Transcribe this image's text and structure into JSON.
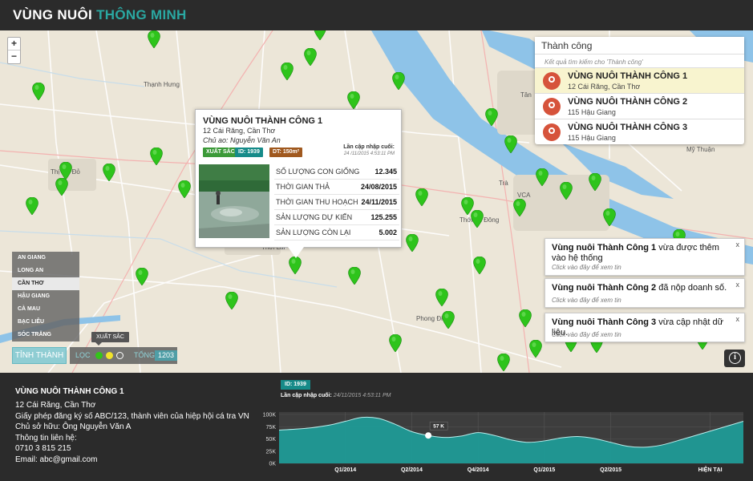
{
  "header": {
    "brand_part1": "VÙNG NUÔI",
    "brand_part2": "THÔNG MINH"
  },
  "map": {
    "zoom_in": "+",
    "zoom_out": "−",
    "places": [
      "Thạnh Hưng",
      "Thị Cờ Đỏ",
      "Thới Lai",
      "Tân",
      "Mỹ Thuận",
      "Trà",
      "Thới An Đông",
      "Phong Điền",
      "VCA"
    ]
  },
  "search": {
    "query": "Thành công",
    "caption": "Kết quả tìm kiếm cho 'Thành công'",
    "results": [
      {
        "name": "VÙNG NUÔI THÀNH CÔNG 1",
        "address": "12 Cái Răng, Cần Thơ"
      },
      {
        "name": "VÙNG NUÔI THÀNH CÔNG 2",
        "address": "115 Hậu Giang"
      },
      {
        "name": "VÙNG NUÔI THÀNH CÔNG 3",
        "address": "115 Hậu Giang"
      }
    ]
  },
  "popup": {
    "title": "VÙNG NUÔI THÀNH CÔNG 1",
    "address": "12 Cái Răng, Cần Thơ",
    "owner": "Chủ ao: Nguyễn Văn An",
    "tag_grade": "XUẤT SẮC",
    "tag_id": "ID: 1939",
    "tag_area": "DT: 150m²",
    "updated_label": "Lần cập nhập cuối:",
    "updated_time": "24 /11/2015 4:53:11 PM",
    "stats": [
      {
        "label": "SỐ LƯỢNG CON GIỐNG",
        "value": "12.345"
      },
      {
        "label": "THỜI GIAN THẢ",
        "value": "24/08/2015"
      },
      {
        "label": "THỜI GIAN THU HOẠCH",
        "value": "24/11/2015"
      },
      {
        "label": "SẢN LƯỢNG DỰ KIẾN",
        "value": "125.255"
      },
      {
        "label": "SẢN LƯỢNG CÒN LẠI",
        "value": "5.002"
      }
    ]
  },
  "provinces": [
    "AN GIANG",
    "LONG AN",
    "CẦN THƠ",
    "HẬU GIANG",
    "CÀ MAU",
    "BẠC LIÊU",
    "SÓC TRĂNG"
  ],
  "active_province": "CẦN THƠ",
  "filter": {
    "province_button": "TỈNH THÀNH",
    "filter_label": "LỌC",
    "tooltip": "XUẤT SẮC",
    "total_label": "TỔNG",
    "total_value": "1203",
    "dot_colors": [
      "#34c419",
      "#f2e42a",
      "#ffffff"
    ]
  },
  "notifications": [
    {
      "bold": "Vùng nuôi Thành Công 1",
      "text": " vừa được thêm vào hệ thống",
      "sub": "Click vào đây để xem tin"
    },
    {
      "bold": "Vùng nuôi Thành Công 2",
      "text": " đã nộp doanh số.",
      "sub": "Click vào đây để xem tin"
    },
    {
      "bold": "Vùng nuôi Thành Công 3",
      "text": " vừa cập nhật dữ liệu.",
      "sub": "Click vào đây để xem tin"
    }
  ],
  "info_button": "i",
  "farm": {
    "title": "VÙNG NUÔI THÀNH CÔNG 1",
    "lines": [
      "12 Cái Răng, Cần Thơ",
      "Giấy phép đăng ký số ABC/123, thành viên của hiệp hội cá tra VN",
      "Chủ sở hữu: Ông Nguyễn Văn A",
      "Thông tin liên hệ:",
      "0710 3 815 215",
      "Email: abc@gmail.com"
    ]
  },
  "chart_header": {
    "id_badge": "ID: 1939",
    "updated_label": "Lần cập nhập cuối:",
    "updated_time": "24/11/2015 4:53:11 PM"
  },
  "colors": {
    "accent": "#2aa8a2",
    "pin": "#2ec41b",
    "chart_fill": "#1f9a96",
    "header_bg": "#2b2b2b"
  },
  "chart_data": {
    "type": "area",
    "x": [
      0,
      0.25,
      0.5,
      0.75,
      1,
      1.25,
      1.5,
      1.75,
      2,
      2.25,
      2.5,
      2.75,
      3,
      3.25,
      3.5,
      3.75,
      4,
      4.25,
      4.5,
      4.75,
      5,
      5.25,
      5.5,
      5.75,
      6,
      6.25,
      6.5,
      6.75,
      7
    ],
    "values": [
      68,
      70,
      73,
      78,
      86,
      94,
      92,
      80,
      65,
      57,
      53,
      56,
      63,
      57,
      48,
      43,
      46,
      52,
      55,
      51,
      43,
      35,
      33,
      37,
      46,
      56,
      66,
      76,
      86
    ],
    "categories": [
      "Q1/2014",
      "Q2/2014",
      "Q4/2014",
      "Q1/2015",
      "Q2/2015",
      "HIỆN TẠI"
    ],
    "category_x": [
      1,
      2,
      3,
      4,
      5,
      6.5
    ],
    "y_ticks": [
      "0K",
      "25K",
      "50K",
      "75K",
      "100K"
    ],
    "y_tick_values": [
      0,
      25,
      50,
      75,
      100
    ],
    "ylim": [
      0,
      100
    ],
    "highlight": {
      "x": 2.25,
      "value": 57,
      "label": "57 K"
    }
  }
}
